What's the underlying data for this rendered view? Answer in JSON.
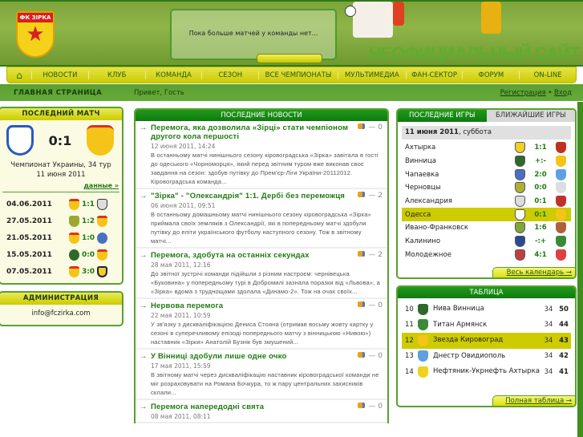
{
  "header": {
    "logo_text": "ФК ЗІРКА",
    "notice": "Пока больше матчей у команды нет...",
    "slogan": "НЕОФИЦИАЛЬНЫЙ САЙТ"
  },
  "nav": {
    "home_icon": "home-icon",
    "items": [
      "НОВОСТИ",
      "КЛУБ",
      "КОМАНДА",
      "СЕЗОН",
      "ВСЕ ЧЕМПИОНАТЫ",
      "МУЛЬТИМЕДИА",
      "ФАН-СЕКТОР",
      "ФОРУМ",
      "ON-LINE"
    ]
  },
  "subbar": {
    "title": "ГЛАВНАЯ СТРАНИЦА",
    "greeting": "Привет, Гость",
    "register": "Регистрация",
    "separator": "•",
    "login": "Вход"
  },
  "last_match": {
    "title": "ПОСЛЕДНИЙ МАТЧ",
    "score": "0:1",
    "competition": "Чемпионат Украины, 34 тур",
    "date": "11 июня 2011",
    "more": "данные »",
    "recent": [
      {
        "date": "04.06.2011",
        "score": "1:1"
      },
      {
        "date": "27.05.2011",
        "score": "1:2"
      },
      {
        "date": "21.05.2011",
        "score": "1:0"
      },
      {
        "date": "15.05.2011",
        "score": "0:0"
      },
      {
        "date": "07.05.2011",
        "score": "3:0"
      }
    ]
  },
  "admin": {
    "title": "АДМИНИСТРАЦИЯ",
    "email": "info@fczirka.com"
  },
  "news": {
    "title": "ПОСЛЕДНИЕ НОВОСТИ",
    "items": [
      {
        "title": "Перемога, яка дозволила «Зірці» стати чемпіоном другого кола першості",
        "date": "12 июня 2011, 14:24",
        "comments": "— 0",
        "text": "В останньому матчі нинішнього сезону кіровоградська «Зірка» завітала в гості до одеського «Чорноморця», який перед звітним туром вже виконав своє завдання на сезон: здобув путівку до Прем'єр-Ліги України-20112012. Кіровоградська команда..."
      },
      {
        "title": "\"Зірка\" - \"Олександрія\" 1:1. Дербі без переможця",
        "date": "06 июня 2011, 09:51",
        "comments": "— 2",
        "text": "В останньому домашньому матчі нинішнього сезону кіровоградська «Зірка» приймала своїх земляків з Олександрії, які в попередньому матчі здобули путівку до еліти українського футболу наступного сезону. Тож в звітному матчі..."
      },
      {
        "title": "Перемога, здобута на останніх секундах",
        "date": "28 мая 2011, 12:16",
        "comments": "— 2",
        "text": "До звітної зустрічі команди підійшли з різним настроєм: чернівецька «Буковина» у попередньому турі в Добромилі зазнала поразки від «Львова», а «Зірка» вдома з труднощами здолала «Динамо-2». Тож на очах своїх..."
      },
      {
        "title": "Нервова перемога",
        "date": "22 мая 2011, 10:59",
        "comments": "— 0",
        "text": "У зв'язку з дискваліфікацією Дениса Стояна (отримав восьму жовту картку у сезоні в суперечливому епізоді попереднього матчу з вінницькою «Нивою») наставник «Зірки» Анатолій Бузнік був змушений..."
      },
      {
        "title": "У Вінниці здобули лише одне очко",
        "date": "17 мая 2011, 15:59",
        "comments": "— 0",
        "text": "В звітному матчі через дискваліфікацію наставник кіровоградської команди не міг розраховувати на Романа Бочкура, то ж пару центральних захисників склали..."
      },
      {
        "title": "Перемога напередодні свята",
        "date": "08 мая 2011, 08:11",
        "comments": "— 0",
        "text": ""
      }
    ]
  },
  "games": {
    "tab_last": "ПОСЛЕДНИЕ ИГРЫ",
    "tab_next": "БЛИЖАЙШИЕ ИГРЫ",
    "date": "11 июня 2011",
    "weekday": ", суббота",
    "more": "Весь календарь →",
    "rows": [
      {
        "city": "Ахтырка",
        "score": "1:1"
      },
      {
        "city": "Винница",
        "score": "+:-"
      },
      {
        "city": "Чапаевка",
        "score": "2:0"
      },
      {
        "city": "Черновцы",
        "score": "0:0"
      },
      {
        "city": "Александрия",
        "score": "0:1"
      },
      {
        "city": "Одесса",
        "score": "0:1",
        "highlight": true
      },
      {
        "city": "Ивано-Франковск",
        "score": "1:6"
      },
      {
        "city": "Калинино",
        "score": "-:+"
      },
      {
        "city": "Молодежное",
        "score": "4:1"
      }
    ]
  },
  "table": {
    "title": "ТАБЛИЦА",
    "more": "Полная таблица →",
    "rows": [
      {
        "pos": "10",
        "team": "Нива Винница",
        "games": "34",
        "points": "50"
      },
      {
        "pos": "11",
        "team": "Титан Армянск",
        "games": "34",
        "points": "44"
      },
      {
        "pos": "12",
        "team": "Звезда Кировоград",
        "games": "34",
        "points": "43",
        "highlight": true
      },
      {
        "pos": "13",
        "team": "Днестр Овидиополь",
        "games": "34",
        "points": "42"
      },
      {
        "pos": "14",
        "team": "Нефтяник-Укрнефть Ахтырка",
        "games": "34",
        "points": "41"
      }
    ]
  },
  "colors": {
    "green": "#1f7a10",
    "yellow": "#cccc00"
  }
}
